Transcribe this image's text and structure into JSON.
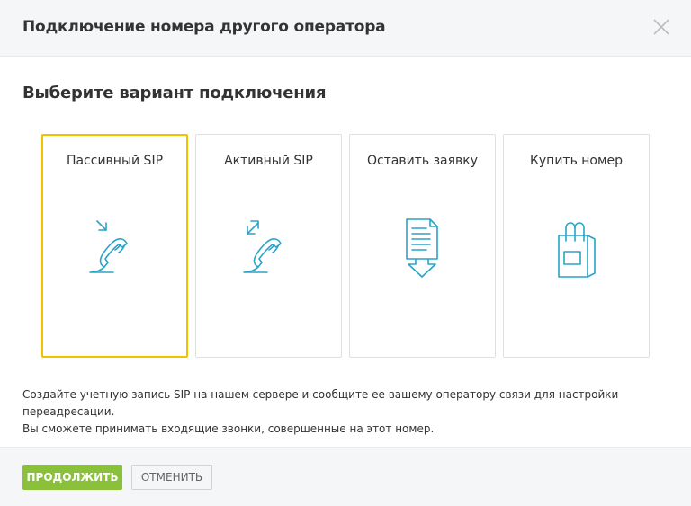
{
  "dialog": {
    "title": "Подключение номера другого оператора"
  },
  "section": {
    "title": "Выберите вариант подключения"
  },
  "options": [
    {
      "label": "Пассивный SIP",
      "icon": "phone-incoming-icon",
      "selected": true
    },
    {
      "label": "Активный SIP",
      "icon": "phone-outgoing-icon",
      "selected": false
    },
    {
      "label": "Оставить заявку",
      "icon": "document-download-icon",
      "selected": false
    },
    {
      "label": "Купить номер",
      "icon": "shopping-bag-icon",
      "selected": false
    }
  ],
  "description": {
    "line1": "Создайте учетную запись SIP на нашем сервере и сообщите ее вашему оператору связи для настройки переадресации.",
    "line2": "Вы сможете принимать входящие звонки, совершенные на этот номер."
  },
  "footer": {
    "continue_label": "ПРОДОЛЖИТЬ",
    "cancel_label": "ОТМЕНИТЬ"
  },
  "colors": {
    "accent_green": "#8ac03a",
    "selected_border": "#f2c200",
    "icon_blue": "#29a3c9"
  }
}
